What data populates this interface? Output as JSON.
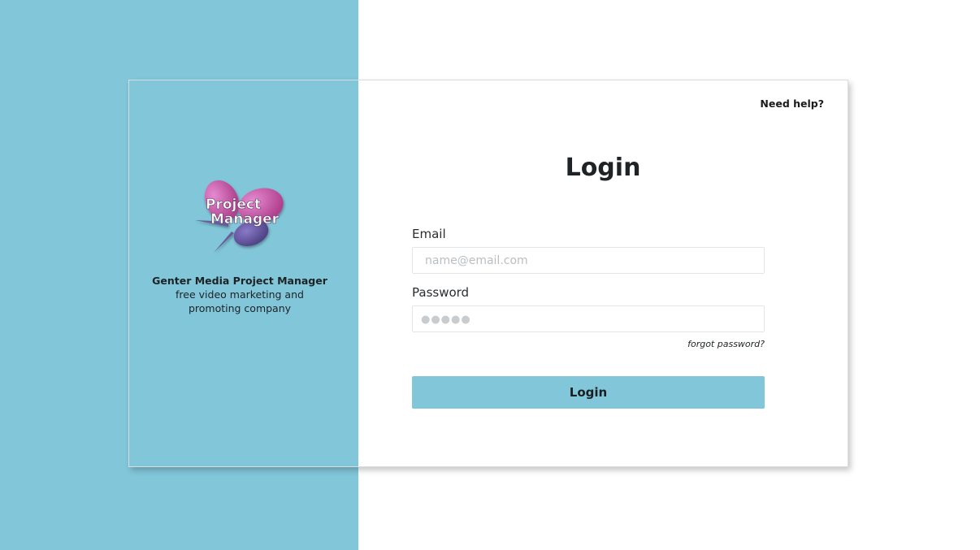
{
  "brand": {
    "logo_text_line1": "Project",
    "logo_text_line2": "Manager",
    "name": "Genter Media Project Manager",
    "tagline": "free video marketing and promoting company"
  },
  "header": {
    "help_link": "Need help?"
  },
  "login_form": {
    "title": "Login",
    "email_label": "Email",
    "email_placeholder": "name@email.com",
    "email_value": "",
    "password_label": "Password",
    "password_placeholder": "●●●●●",
    "password_value": "",
    "forgot_password": "forgot password?",
    "submit_label": "Login"
  },
  "colors": {
    "accent": "#82c6d9",
    "card_background": "#ffffff",
    "text": "#1f2326",
    "logo_pink": "#c25aa0",
    "logo_purple": "#5b4f8f"
  },
  "icons": {
    "logo": "project-manager-logo"
  }
}
